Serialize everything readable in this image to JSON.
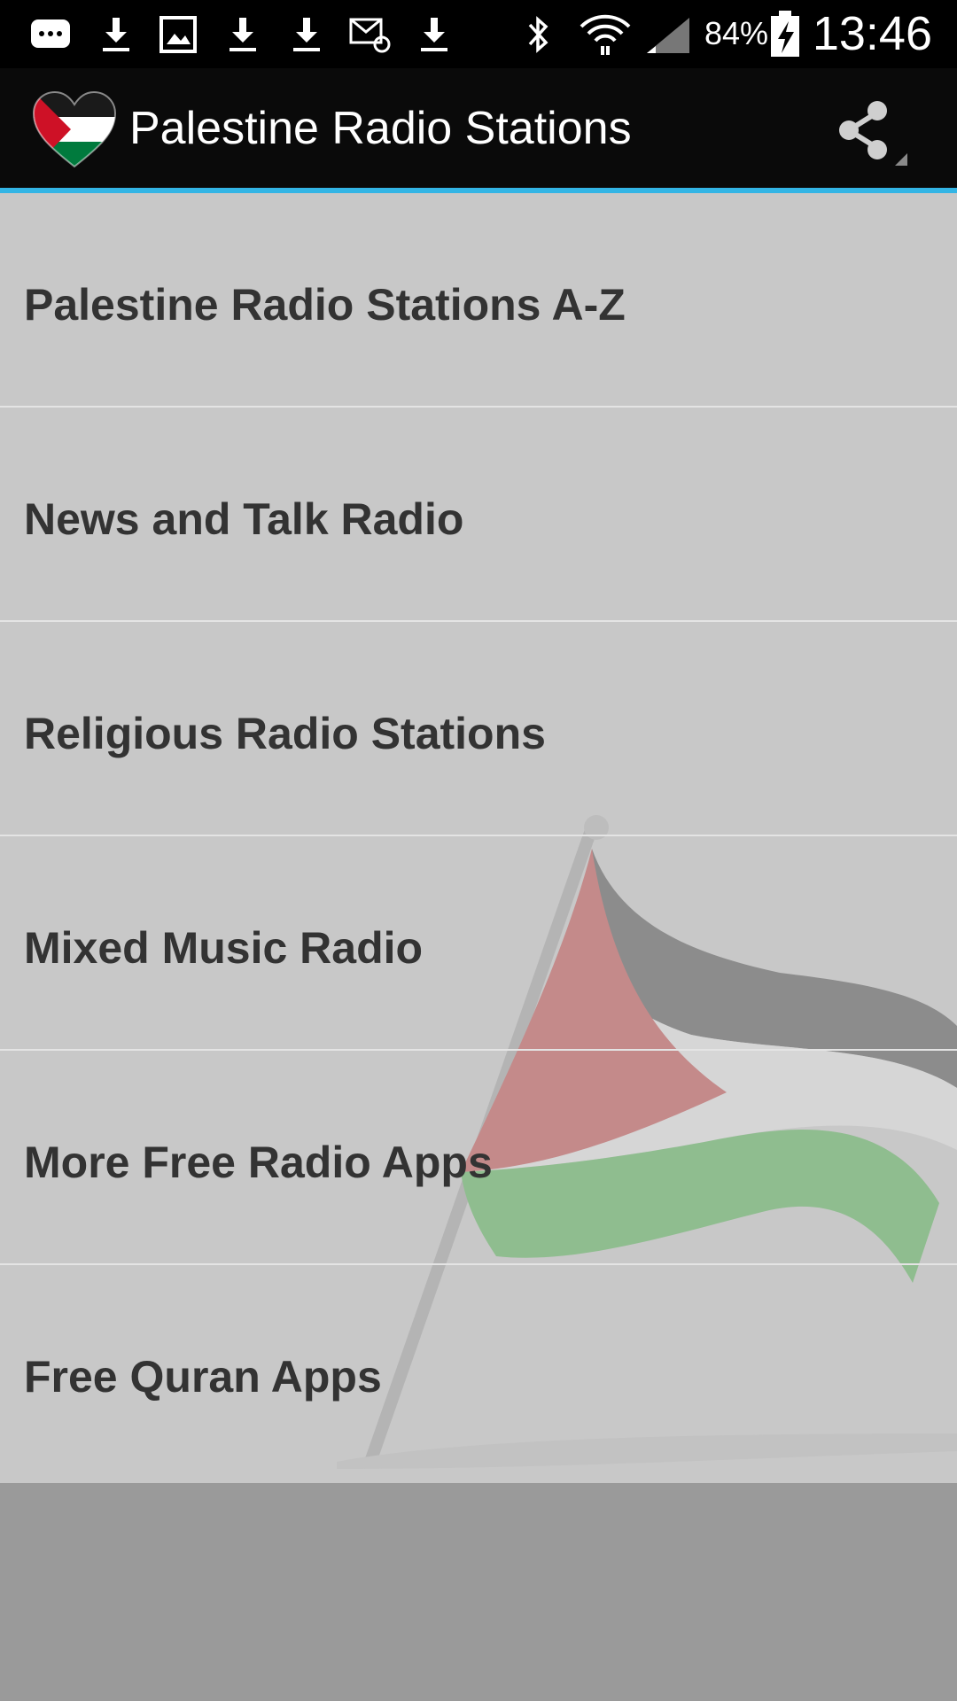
{
  "status_bar": {
    "battery_percent": "84%",
    "time": "13:46",
    "notification_icons": [
      "sms-icon",
      "download-icon",
      "image-icon",
      "download-icon",
      "download-icon",
      "email-icon",
      "download-icon"
    ],
    "system_icons": [
      "bluetooth-icon",
      "wifi-icon",
      "signal-icon",
      "battery-charging-icon"
    ]
  },
  "action_bar": {
    "title": "Palestine Radio Stations",
    "logo_icon": "palestine-heart-flag-icon",
    "share_icon": "share-icon",
    "accent_color": "#33b5e5"
  },
  "menu": {
    "items": [
      {
        "label": "Palestine Radio Stations A-Z"
      },
      {
        "label": "News and Talk Radio"
      },
      {
        "label": "Religious Radio Stations"
      },
      {
        "label": "Mixed Music Radio"
      },
      {
        "label": "More Free Radio Apps"
      },
      {
        "label": "Free Quran Apps"
      }
    ]
  },
  "colors": {
    "flag_red": "#ce1126",
    "flag_black": "#000000",
    "flag_white": "#ffffff",
    "flag_green": "#007a3d"
  }
}
